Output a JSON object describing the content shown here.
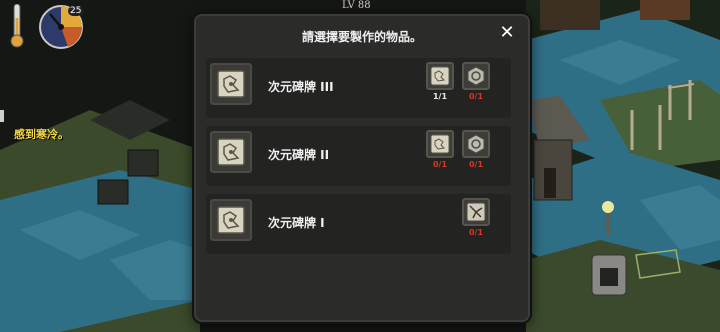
{
  "hud": {
    "level": "LV 88",
    "status_message": "感到寒冷。",
    "clock_label": "25"
  },
  "dialog": {
    "title": "請選擇要製作的物品。",
    "close_label": "✕",
    "recipes": [
      {
        "name": "次元碑牌 III",
        "ingredients": [
          {
            "icon": "tablet-fragment-icon",
            "count": "1/1",
            "status": "ok"
          },
          {
            "icon": "hexagon-core-icon",
            "count": "0/1",
            "status": "missing"
          }
        ]
      },
      {
        "name": "次元碑牌 II",
        "ingredients": [
          {
            "icon": "tablet-fragment-icon",
            "count": "0/1",
            "status": "missing"
          },
          {
            "icon": "hexagon-core-icon",
            "count": "0/1",
            "status": "missing"
          }
        ]
      },
      {
        "name": "次元碑牌 I",
        "ingredients": [
          {
            "icon": "cracked-stone-icon",
            "count": "0/1",
            "status": "missing"
          }
        ]
      }
    ]
  },
  "colors": {
    "panel": "#2b2b2a",
    "row": "#232322",
    "warning_text": "#f3d64a",
    "count_missing": "#d23a2a",
    "water": "#2f6f86"
  }
}
